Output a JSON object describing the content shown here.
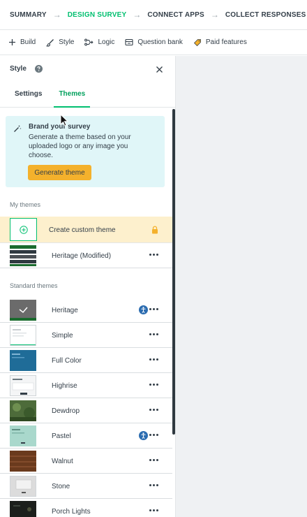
{
  "steps": [
    {
      "label": "SUMMARY"
    },
    {
      "label": "DESIGN SURVEY"
    },
    {
      "label": "CONNECT APPS"
    },
    {
      "label": "COLLECT RESPONSES"
    }
  ],
  "toolbar": {
    "build": "Build",
    "style": "Style",
    "logic": "Logic",
    "question_bank": "Question bank",
    "paid_features": "Paid features"
  },
  "panel": {
    "title": "Style",
    "tabs": {
      "settings": "Settings",
      "themes": "Themes"
    },
    "brand": {
      "title": "Brand your survey",
      "description": "Generate a theme based on your uploaded logo or any image you choose.",
      "button": "Generate theme"
    },
    "my_themes_label": "My themes",
    "create_custom": "Create custom theme",
    "my_themes": [
      {
        "name": "Heritage (Modified)"
      }
    ],
    "standard_themes_label": "Standard themes",
    "standard_themes": [
      {
        "name": "Heritage",
        "accessible": true
      },
      {
        "name": "Simple",
        "accessible": false
      },
      {
        "name": "Full Color",
        "accessible": false
      },
      {
        "name": "Highrise",
        "accessible": false
      },
      {
        "name": "Dewdrop",
        "accessible": false
      },
      {
        "name": "Pastel",
        "accessible": true
      },
      {
        "name": "Walnut",
        "accessible": false
      },
      {
        "name": "Stone",
        "accessible": false
      },
      {
        "name": "Porch Lights",
        "accessible": false
      }
    ]
  },
  "colors": {
    "accent_green": "#00bf6f",
    "generate_button": "#f4b12c",
    "brand_box_bg": "#e0f6f8",
    "create_row_bg": "#fdf0cd",
    "a11y_badge": "#2b6cb0"
  }
}
